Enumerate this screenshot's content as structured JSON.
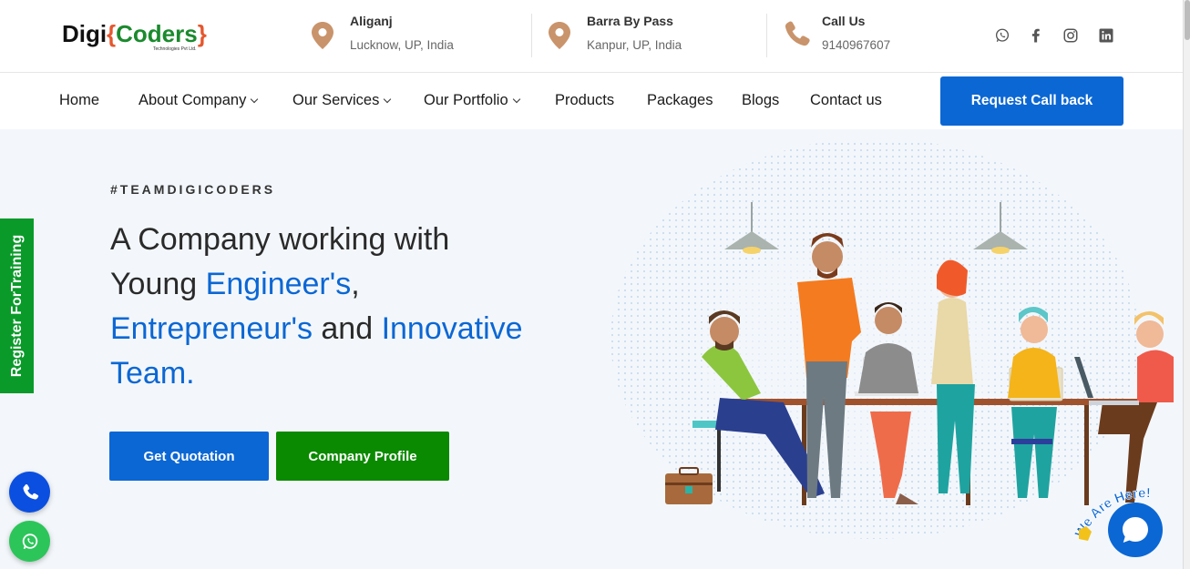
{
  "logo": {
    "part1": "Digi",
    "brace_open": "{",
    "part2": "Coders",
    "brace_close": "}",
    "tagline": "Technologies Pvt Ltd."
  },
  "contacts": [
    {
      "title": "Aliganj",
      "subtitle": "Lucknow, UP, India",
      "icon": "location-pin-icon"
    },
    {
      "title": "Barra By Pass",
      "subtitle": "Kanpur, UP, India",
      "icon": "location-pin-icon"
    },
    {
      "title": "Call Us",
      "subtitle": "9140967607",
      "icon": "phone-icon"
    }
  ],
  "social": [
    "whatsapp-icon",
    "facebook-icon",
    "instagram-icon",
    "linkedin-icon"
  ],
  "nav": {
    "items": [
      "Home",
      "About Company",
      "Our Services",
      "Our Portfolio",
      "Products",
      "Packages",
      "Blogs",
      "Contact us"
    ],
    "cta": "Request Call back"
  },
  "hero": {
    "tagline": "#TEAMDIGICODERS",
    "line1": "A Company working with",
    "line2a": "Young ",
    "line2b": "Engineer's",
    "line2c": ",",
    "line3a": "Entrepreneur's",
    "line3b": " and ",
    "line3c": "Innovative",
    "line4": "Team.",
    "btn_quote": "Get Quotation",
    "btn_profile": "Company Profile"
  },
  "side": {
    "register": "Register ForTraining"
  },
  "chat": {
    "badge": "We Are Here!"
  },
  "colors": {
    "primary": "#0b67d4",
    "green": "#0a8a00",
    "register_green": "#0a9a2a",
    "pin": "#c9946b"
  }
}
